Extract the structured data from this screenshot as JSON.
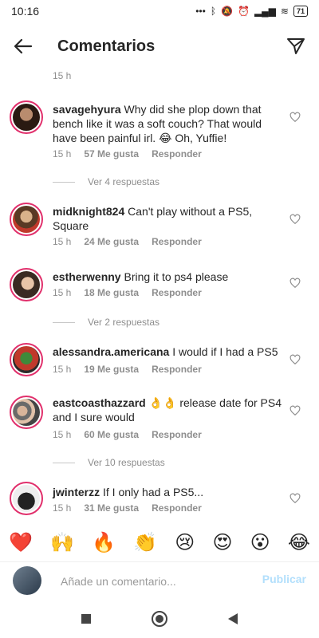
{
  "status": {
    "time": "10:16",
    "battery": "71"
  },
  "header": {
    "title": "Comentarios"
  },
  "top_meta": {
    "time": "15 h"
  },
  "comments": [
    {
      "user": "savagehyura",
      "text": "Why did she plop down that bench like it was a soft couch? That would have been painful irl. 😂 Oh, Yuffie!",
      "time": "15 h",
      "likes": "57 Me gusta",
      "reply": "Responder"
    },
    {
      "user": "midknight824",
      "text": "Can't play without a PS5, Square",
      "time": "15 h",
      "likes": "24 Me gusta",
      "reply": "Responder"
    },
    {
      "user": "estherwenny",
      "text": "Bring it to ps4 please",
      "time": "15 h",
      "likes": "18 Me gusta",
      "reply": "Responder"
    },
    {
      "user": "alessandra.americana",
      "text": "I would if I had a PS5",
      "time": "15 h",
      "likes": "19 Me gusta",
      "reply": "Responder"
    },
    {
      "user": "eastcoasthazzard",
      "text": "👌👌 release date for PS4 and I sure would",
      "time": "15 h",
      "likes": "60 Me gusta",
      "reply": "Responder"
    },
    {
      "user": "jwinterzz",
      "text": "If I only had a PS5...",
      "time": "15 h",
      "likes": "31 Me gusta",
      "reply": "Responder"
    }
  ],
  "view_replies": [
    "Ver 4 respuestas",
    "Ver 2 respuestas",
    "Ver 10 respuestas"
  ],
  "emojis": [
    "❤️",
    "🙌",
    "🔥",
    "👏",
    "😢",
    "😍",
    "😮",
    "😂"
  ],
  "compose": {
    "placeholder": "Añade un comentario...",
    "publish": "Publicar"
  },
  "colors": {
    "accent": "#e1306c",
    "publish": "#b2dffc",
    "meta": "#8e8e8e"
  },
  "icons": {
    "back": "arrow-left-icon",
    "send": "paper-plane-icon",
    "heart": "heart-outline-icon"
  }
}
